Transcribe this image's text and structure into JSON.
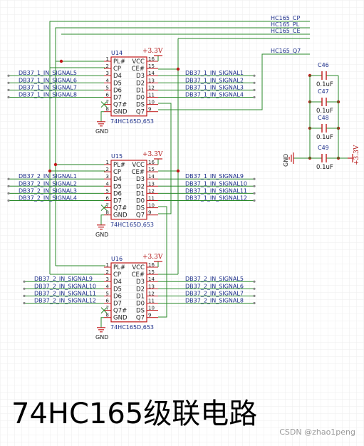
{
  "title": "74HC165级联电路",
  "watermark": "CSDN @zhao1peng",
  "top_nets": [
    "HC165_CP",
    "HC165_PL",
    "HC165_CE",
    "HC165_Q7"
  ],
  "chips": [
    {
      "ref": "U14",
      "part": "74HC165D,653",
      "power": "+3.3V",
      "gnd": "GND",
      "left_nets": [
        "DB37_1_IN_SIGNAL5",
        "DB37_1_IN_SIGNAL6",
        "DB37_1_IN_SIGNAL7",
        "DB37_1_IN_SIGNAL8"
      ],
      "right_nets": [
        "DB37_1_IN_SIGNAL1",
        "DB37_1_IN_SIGNAL2",
        "DB37_1_IN_SIGNAL3",
        "DB37_1_IN_SIGNAL4"
      ]
    },
    {
      "ref": "U15",
      "part": "74HC165D,653",
      "power": "+3.3V",
      "gnd": "GND",
      "left_nets": [
        "DB37_2_IN_SIGNAL1",
        "DB37_2_IN_SIGNAL2",
        "DB37_2_IN_SIGNAL3",
        "DB37_2_IN_SIGNAL4"
      ],
      "right_nets": [
        "DB37_1_IN_SIGNAL9",
        "DB37_1_IN_SIGNAL10",
        "DB37_1_IN_SIGNAL11",
        "DB37_1_IN_SIGNAL12"
      ]
    },
    {
      "ref": "U16",
      "part": "74HC165D,653",
      "power": "+3.3V",
      "gnd": "GND",
      "left_nets": [
        "DB37_2_IN_SIGNAL9",
        "DB37_2_IN_SIGNAL10",
        "DB37_2_IN_SIGNAL11",
        "DB37_2_IN_SIGNAL12"
      ],
      "right_nets": [
        "DB37_2_IN_SIGNAL5",
        "DB37_2_IN_SIGNAL6",
        "DB37_2_IN_SIGNAL7",
        "DB37_2_IN_SIGNAL8"
      ]
    }
  ],
  "pin_names_left": [
    "PL#",
    "CP",
    "D4",
    "D5",
    "D6",
    "D7",
    "Q7#",
    "GND"
  ],
  "pin_nums_left": [
    "1",
    "2",
    "3",
    "4",
    "5",
    "6",
    "7",
    "8"
  ],
  "pin_names_right": [
    "VCC",
    "CE#",
    "D3",
    "D2",
    "D1",
    "D0",
    "DS",
    "Q7"
  ],
  "pin_nums_right": [
    "16",
    "15",
    "14",
    "13",
    "12",
    "11",
    "10",
    "9"
  ],
  "capacitors": [
    {
      "ref": "C46",
      "value": "0.1uF"
    },
    {
      "ref": "C47",
      "value": "0.1uF"
    },
    {
      "ref": "C48",
      "value": "0.1uF"
    },
    {
      "ref": "C49",
      "value": "0.1uF"
    }
  ],
  "cap_gnd": "GND",
  "cap_power": "+3.3V",
  "colors": {
    "wire": "#2a8a2a",
    "body": "#c01818",
    "net": "#1d2f8a",
    "junction": "#c01818",
    "grid": "#eeeeee"
  }
}
